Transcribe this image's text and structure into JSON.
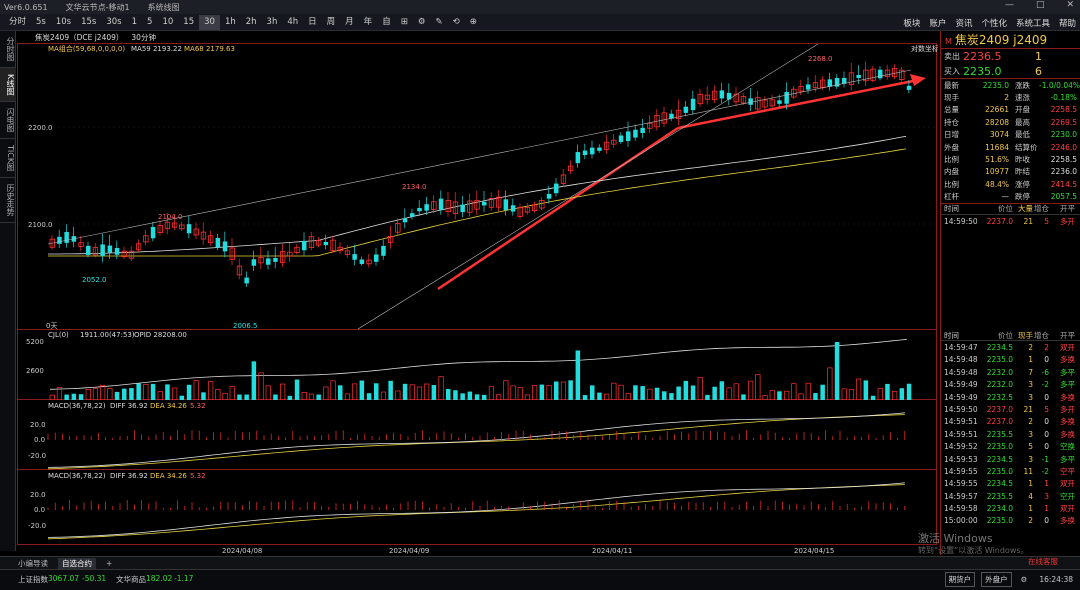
{
  "titlebar": {
    "app": "Ver6.0.651",
    "items": [
      "文华云节点-移动1",
      "系统线图"
    ],
    "controls": [
      "—",
      "□",
      "✕"
    ]
  },
  "toolbar": {
    "left": [
      "1",
      "5",
      "15",
      "30",
      "1h",
      "2h",
      "3h",
      "4h",
      "日",
      "周",
      "月",
      "年",
      "自",
      "1",
      "5",
      "10",
      "15",
      "30",
      "1h",
      "2h",
      "3h",
      "4h",
      "日",
      "周",
      "月",
      "年"
    ],
    "left_prefix": [
      "分时",
      "5s",
      "10s",
      "15s",
      "30s"
    ],
    "right": [
      "板块",
      "账户",
      "资讯",
      "个性化",
      "系统工具",
      "帮助"
    ]
  },
  "left_tabs": [
    "分时图",
    "K线图",
    "闪电图",
    "TICK图",
    "历史走势"
  ],
  "chart_header": {
    "symbol": "焦炭2409（DCE j2409）",
    "period": "30分钟"
  },
  "indicators": {
    "ma_line": "MA组合(59,68,0,0,0,0)",
    "ma59": "MA59 2193.22",
    "ma68": "MA68 2179.63",
    "corner_label": "对数坐标",
    "price_ticks": [
      "2200.0",
      "2100.0"
    ],
    "annotations": [
      "2268.0",
      "2134.0",
      "2104.0",
      "2052.0",
      "2006.5"
    ],
    "bottom_label": "0天",
    "vol_header": "CJL(0)",
    "vol_values": "1911.00(47:53)",
    "opid": "OPID 28208.00",
    "vol_ticks": [
      "5200",
      "2600"
    ],
    "macd1_header": "MACD(36,78,22)",
    "macd1_diff": "DIFF 36.92",
    "macd1_dea": "DEA 34.26",
    "macd1_val": "5.32",
    "macd2_header": "MACD(36,78,22)",
    "macd2_diff": "DIFF 36.92",
    "macd2_dea": "DEA 34.26",
    "macd2_val": "5.32",
    "macd_ticks": [
      "20.0",
      "0.0",
      "-20.0"
    ],
    "dates": [
      "2024/04/08",
      "2024/04/09",
      "2024/04/11",
      "2024/04/15"
    ]
  },
  "right_panel": {
    "m": "M",
    "title": "焦炭2409 j2409",
    "sell_label": "卖出",
    "sell_price": "2236.5",
    "sell_qty": "1",
    "buy_label": "买入",
    "buy_price": "2235.0",
    "buy_qty": "6",
    "quote_rows": [
      {
        "l": "最新",
        "v": "2235.0",
        "vc": "green",
        "l2": "涨跌",
        "v2": "-1.0/0.04%",
        "v2c": "green"
      },
      {
        "l": "现手",
        "v": "2",
        "vc": "yellow",
        "l2": "速涨",
        "v2": "-0.18%",
        "v2c": "green"
      },
      {
        "l": "总量",
        "v": "22661",
        "vc": "yellow",
        "l2": "开盘",
        "v2": "2258.5",
        "v2c": "red"
      },
      {
        "l": "持仓",
        "v": "28208",
        "vc": "yellow",
        "l2": "最高",
        "v2": "2269.5",
        "v2c": "red"
      },
      {
        "l": "日增",
        "v": "3074",
        "vc": "yellow",
        "l2": "最低",
        "v2": "2230.0",
        "v2c": "green"
      },
      {
        "l": "外盘",
        "v": "11684",
        "vc": "yellow",
        "l2": "结算价",
        "v2": "2246.0",
        "v2c": "red"
      },
      {
        "l": "比例",
        "v": "51.6%",
        "vc": "yellow",
        "l2": "昨收",
        "v2": "2258.5",
        "v2c": "white"
      },
      {
        "l": "内盘",
        "v": "10977",
        "vc": "yellow",
        "l2": "昨结",
        "v2": "2236.0",
        "v2c": "white"
      },
      {
        "l": "比例",
        "v": "48.4%",
        "vc": "yellow",
        "l2": "涨停",
        "v2": "2414.5",
        "v2c": "red"
      },
      {
        "l": "杠杆",
        "v": "—",
        "vc": "white",
        "l2": "跌停",
        "v2": "2057.5",
        "v2c": "green"
      }
    ],
    "tick_head": [
      "时间",
      "价位",
      "大量",
      "增仓",
      "开平"
    ],
    "tick_top": [
      {
        "t": "14:59:50",
        "p": "2237.0",
        "pc": "red",
        "v": "21",
        "o": "5",
        "k": "多开",
        "kc": "red"
      }
    ],
    "tick_head2": [
      "时间",
      "价位",
      "现手",
      "增仓",
      "开平"
    ],
    "ticks": [
      {
        "t": "14:59:47",
        "p": "2234.5",
        "pc": "green",
        "v": "2",
        "o": "2",
        "oc": "red",
        "k": "双开",
        "kc": "red"
      },
      {
        "t": "14:59:48",
        "p": "2235.0",
        "pc": "green",
        "v": "1",
        "o": "0",
        "oc": "white",
        "k": "多换",
        "kc": "red"
      },
      {
        "t": "14:59:48",
        "p": "2232.0",
        "pc": "green",
        "v": "7",
        "o": "-6",
        "oc": "green",
        "k": "多平",
        "kc": "green"
      },
      {
        "t": "14:59:49",
        "p": "2232.0",
        "pc": "green",
        "v": "3",
        "o": "-2",
        "oc": "green",
        "k": "多平",
        "kc": "green"
      },
      {
        "t": "14:59:49",
        "p": "2232.5",
        "pc": "green",
        "v": "3",
        "o": "0",
        "oc": "white",
        "k": "多换",
        "kc": "red"
      },
      {
        "t": "14:59:50",
        "p": "2237.0",
        "pc": "red",
        "v": "21",
        "o": "5",
        "oc": "red",
        "k": "多开",
        "kc": "red"
      },
      {
        "t": "14:59:51",
        "p": "2237.0",
        "pc": "red",
        "v": "2",
        "o": "0",
        "oc": "white",
        "k": "多换",
        "kc": "red"
      },
      {
        "t": "14:59:51",
        "p": "2235.5",
        "pc": "green",
        "v": "3",
        "o": "0",
        "oc": "white",
        "k": "多换",
        "kc": "red"
      },
      {
        "t": "14:59:52",
        "p": "2235.0",
        "pc": "green",
        "v": "5",
        "o": "0",
        "oc": "white",
        "k": "空换",
        "kc": "green"
      },
      {
        "t": "14:59:53",
        "p": "2234.5",
        "pc": "green",
        "v": "3",
        "o": "-1",
        "oc": "green",
        "k": "多平",
        "kc": "green"
      },
      {
        "t": "14:59:55",
        "p": "2235.0",
        "pc": "green",
        "v": "11",
        "o": "-2",
        "oc": "green",
        "k": "空平",
        "kc": "red"
      },
      {
        "t": "14:59:55",
        "p": "2234.5",
        "pc": "green",
        "v": "1",
        "o": "1",
        "oc": "red",
        "k": "双开",
        "kc": "red"
      },
      {
        "t": "14:59:57",
        "p": "2235.5",
        "pc": "green",
        "v": "4",
        "o": "3",
        "oc": "red",
        "k": "空开",
        "kc": "green"
      },
      {
        "t": "14:59:58",
        "p": "2234.0",
        "pc": "green",
        "v": "1",
        "o": "1",
        "oc": "red",
        "k": "双开",
        "kc": "red"
      },
      {
        "t": "15:00:00",
        "p": "2235.0",
        "pc": "green",
        "v": "2",
        "o": "0",
        "oc": "white",
        "k": "多换",
        "kc": "red"
      }
    ]
  },
  "bottom_tabs": [
    "小编导读",
    "自选合约",
    "+"
  ],
  "status": {
    "idx1_name": "上证指数",
    "idx1_val": "3067.07",
    "idx1_chg": "-50.31",
    "idx2_name": "文华商品",
    "idx2_val": "182.02",
    "idx2_chg": "-1.17",
    "buttons": [
      "期货户",
      "外盘户"
    ],
    "time": "16:24:38",
    "notice": "在线客服"
  },
  "watermark": {
    "line1": "激活 Windows",
    "line2": "转到“设置”以激活 Windows。"
  }
}
